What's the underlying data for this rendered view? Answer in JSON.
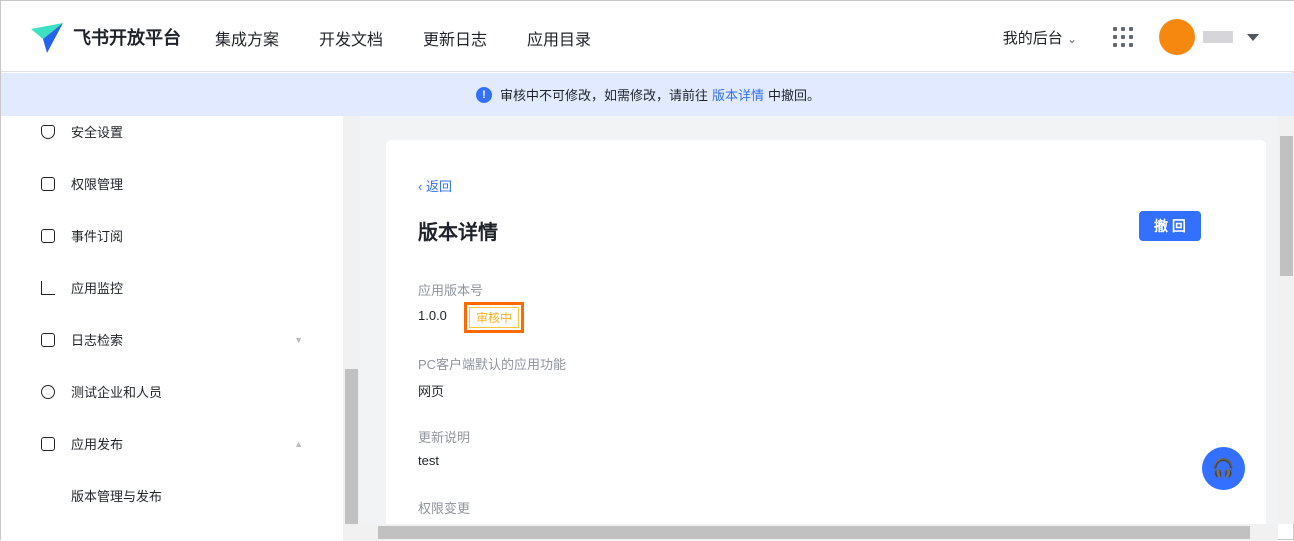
{
  "header": {
    "logo_text": "飞书开放平台",
    "nav": [
      "集成方案",
      "开发文档",
      "更新日志",
      "应用目录"
    ],
    "backend": "我的后台"
  },
  "banner": {
    "before": "审核中不可修改，如需修改，请前往",
    "link": "版本详情",
    "after": "中撤回。"
  },
  "sidebar": {
    "items": [
      {
        "label": "安全设置"
      },
      {
        "label": "权限管理"
      },
      {
        "label": "事件订阅"
      },
      {
        "label": "应用监控"
      },
      {
        "label": "日志检索"
      },
      {
        "label": "测试企业和人员"
      },
      {
        "label": "应用发布"
      },
      {
        "label": "版本管理与发布"
      }
    ]
  },
  "main": {
    "back": "返回",
    "title": "版本详情",
    "withdraw": "撤 回",
    "version_label": "应用版本号",
    "version": "1.0.0",
    "status": "审核中",
    "pc_label": "PC客户端默认的应用功能",
    "pc_value": "网页",
    "notes_label": "更新说明",
    "notes_value": "test",
    "perm_label": "权限变更"
  },
  "colors": {
    "accent": "#3370ff",
    "warning": "#ffb01f"
  }
}
